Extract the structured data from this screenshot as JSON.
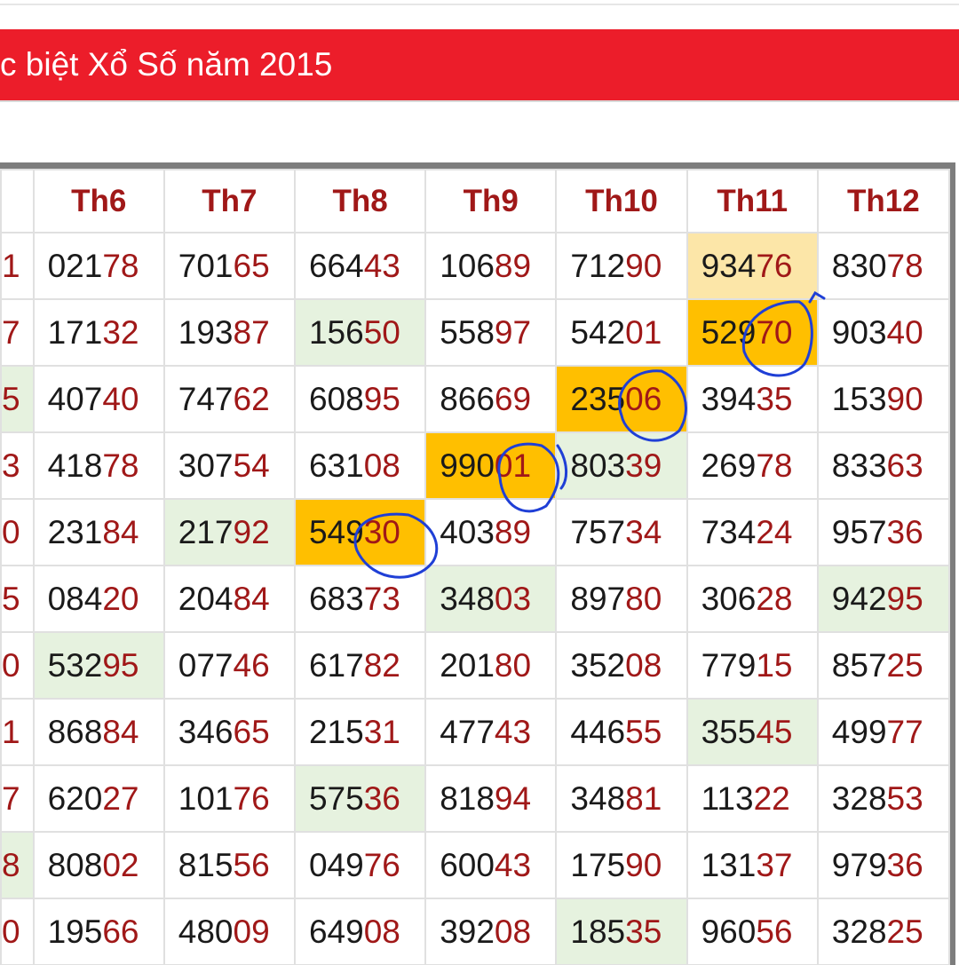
{
  "title": "c biệt Xổ Số năm 2015",
  "columns": [
    "",
    "Th6",
    "Th7",
    "Th8",
    "Th9",
    "Th10",
    "Th11",
    "Th12"
  ],
  "rows": [
    {
      "cells": [
        {
          "head": "",
          "tail": "1"
        },
        {
          "head": "021",
          "tail": "78"
        },
        {
          "head": "701",
          "tail": "65"
        },
        {
          "head": "664",
          "tail": "43"
        },
        {
          "head": "106",
          "tail": "89"
        },
        {
          "head": "712",
          "tail": "90"
        },
        {
          "head": "934",
          "tail": "76",
          "hl": "pale"
        },
        {
          "head": "830",
          "tail": "78"
        }
      ]
    },
    {
      "cells": [
        {
          "head": "",
          "tail": "7"
        },
        {
          "head": "171",
          "tail": "32"
        },
        {
          "head": "193",
          "tail": "87"
        },
        {
          "head": "156",
          "tail": "50",
          "hl": "lg"
        },
        {
          "head": "558",
          "tail": "97"
        },
        {
          "head": "542",
          "tail": "01"
        },
        {
          "head": "529",
          "tail": "70",
          "hl": "gold"
        },
        {
          "head": "903",
          "tail": "40"
        }
      ]
    },
    {
      "cells": [
        {
          "head": "",
          "tail": "5",
          "hl": "lg"
        },
        {
          "head": "407",
          "tail": "40"
        },
        {
          "head": "747",
          "tail": "62"
        },
        {
          "head": "608",
          "tail": "95"
        },
        {
          "head": "866",
          "tail": "69"
        },
        {
          "head": "235",
          "tail": "06",
          "hl": "gold"
        },
        {
          "head": "394",
          "tail": "35"
        },
        {
          "head": "153",
          "tail": "90"
        }
      ]
    },
    {
      "cells": [
        {
          "head": "",
          "tail": "3"
        },
        {
          "head": "418",
          "tail": "78"
        },
        {
          "head": "307",
          "tail": "54"
        },
        {
          "head": "631",
          "tail": "08"
        },
        {
          "head": "990",
          "tail": "01",
          "hl": "gold"
        },
        {
          "head": "803",
          "tail": "39",
          "hl": "lg"
        },
        {
          "head": "269",
          "tail": "78"
        },
        {
          "head": "833",
          "tail": "63"
        }
      ]
    },
    {
      "cells": [
        {
          "head": "",
          "tail": "0"
        },
        {
          "head": "231",
          "tail": "84"
        },
        {
          "head": "217",
          "tail": "92",
          "hl": "lg"
        },
        {
          "head": "549",
          "tail": "30",
          "hl": "gold"
        },
        {
          "head": "403",
          "tail": "89"
        },
        {
          "head": "757",
          "tail": "34"
        },
        {
          "head": "734",
          "tail": "24"
        },
        {
          "head": "957",
          "tail": "36"
        }
      ]
    },
    {
      "cells": [
        {
          "head": "",
          "tail": "5"
        },
        {
          "head": "084",
          "tail": "20"
        },
        {
          "head": "204",
          "tail": "84"
        },
        {
          "head": "683",
          "tail": "73"
        },
        {
          "head": "348",
          "tail": "03",
          "hl": "lg"
        },
        {
          "head": "897",
          "tail": "80"
        },
        {
          "head": "306",
          "tail": "28"
        },
        {
          "head": "942",
          "tail": "95",
          "hl": "lg"
        }
      ]
    },
    {
      "cells": [
        {
          "head": "",
          "tail": "0"
        },
        {
          "head": "532",
          "tail": "95",
          "hl": "lg"
        },
        {
          "head": "077",
          "tail": "46"
        },
        {
          "head": "617",
          "tail": "82"
        },
        {
          "head": "201",
          "tail": "80"
        },
        {
          "head": "352",
          "tail": "08"
        },
        {
          "head": "779",
          "tail": "15"
        },
        {
          "head": "857",
          "tail": "25"
        }
      ]
    },
    {
      "cells": [
        {
          "head": "",
          "tail": "1"
        },
        {
          "head": "868",
          "tail": "84"
        },
        {
          "head": "346",
          "tail": "65"
        },
        {
          "head": "215",
          "tail": "31"
        },
        {
          "head": "477",
          "tail": "43"
        },
        {
          "head": "446",
          "tail": "55"
        },
        {
          "head": "355",
          "tail": "45",
          "hl": "lg"
        },
        {
          "head": "499",
          "tail": "77"
        }
      ]
    },
    {
      "cells": [
        {
          "head": "",
          "tail": "7"
        },
        {
          "head": "620",
          "tail": "27"
        },
        {
          "head": "101",
          "tail": "76"
        },
        {
          "head": "575",
          "tail": "36",
          "hl": "lg"
        },
        {
          "head": "818",
          "tail": "94"
        },
        {
          "head": "348",
          "tail": "81"
        },
        {
          "head": "113",
          "tail": "22"
        },
        {
          "head": "328",
          "tail": "53"
        }
      ]
    },
    {
      "cells": [
        {
          "head": "",
          "tail": "8",
          "hl": "lg"
        },
        {
          "head": "808",
          "tail": "02"
        },
        {
          "head": "815",
          "tail": "56"
        },
        {
          "head": "049",
          "tail": "76"
        },
        {
          "head": "600",
          "tail": "43"
        },
        {
          "head": "175",
          "tail": "90"
        },
        {
          "head": "131",
          "tail": "37"
        },
        {
          "head": "979",
          "tail": "36"
        }
      ]
    },
    {
      "cells": [
        {
          "head": "",
          "tail": "0"
        },
        {
          "head": "195",
          "tail": "66"
        },
        {
          "head": "480",
          "tail": "09"
        },
        {
          "head": "649",
          "tail": "08"
        },
        {
          "head": "392",
          "tail": "08"
        },
        {
          "head": "185",
          "tail": "35",
          "hl": "lg"
        },
        {
          "head": "960",
          "tail": "56"
        },
        {
          "head": "328",
          "tail": "25"
        }
      ]
    }
  ],
  "colors": {
    "banner": "#ec1d2a",
    "header_text": "#a01818",
    "tail_digits": "#a01818",
    "highlight_gold": "#ffbf00",
    "highlight_pale": "#fce6a8",
    "highlight_green": "#e6f2df",
    "annotation_ink": "#1f3fd6"
  }
}
